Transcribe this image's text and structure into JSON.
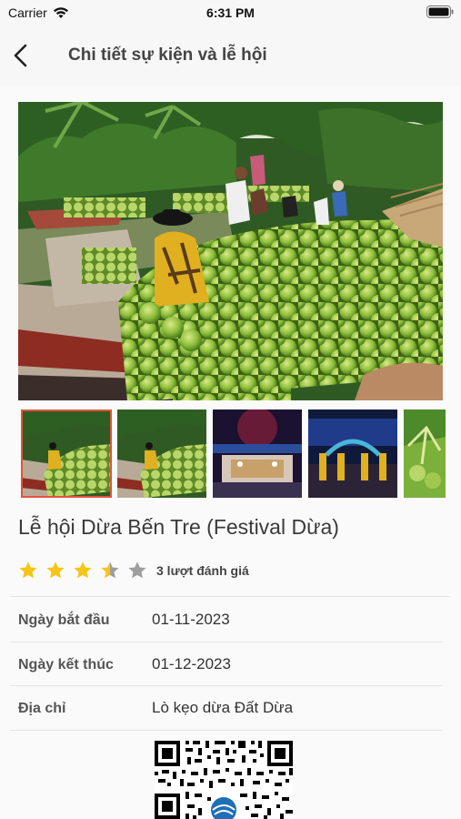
{
  "status_bar": {
    "carrier": "Carrier",
    "time": "6:31 PM"
  },
  "nav": {
    "title": "Chi tiết sự kiện và lễ hội",
    "back_icon": "chevron-left-icon"
  },
  "event": {
    "title": "Lễ hội Dừa Bến Tre (Festival Dừa)",
    "rating": 3.5,
    "rating_max": 5,
    "rating_count_text": "3 lượt đánh giá",
    "star_color": "#f5c518",
    "star_empty_color": "#9e9e9e"
  },
  "gallery": {
    "selected_index": 0,
    "thumbnails": [
      "coconut-market",
      "coconut-market",
      "festival-stage-night",
      "festival-stage-dancers",
      "coconut-tree"
    ]
  },
  "details": [
    {
      "label": "Ngày bắt đầu",
      "value": "01-11-2023"
    },
    {
      "label": "Ngày kết thúc",
      "value": "01-12-2023"
    },
    {
      "label": "Địa chỉ",
      "value": "Lò kẹo dừa Đất Dừa"
    }
  ],
  "colors": {
    "accent_border": "#e0543c"
  }
}
